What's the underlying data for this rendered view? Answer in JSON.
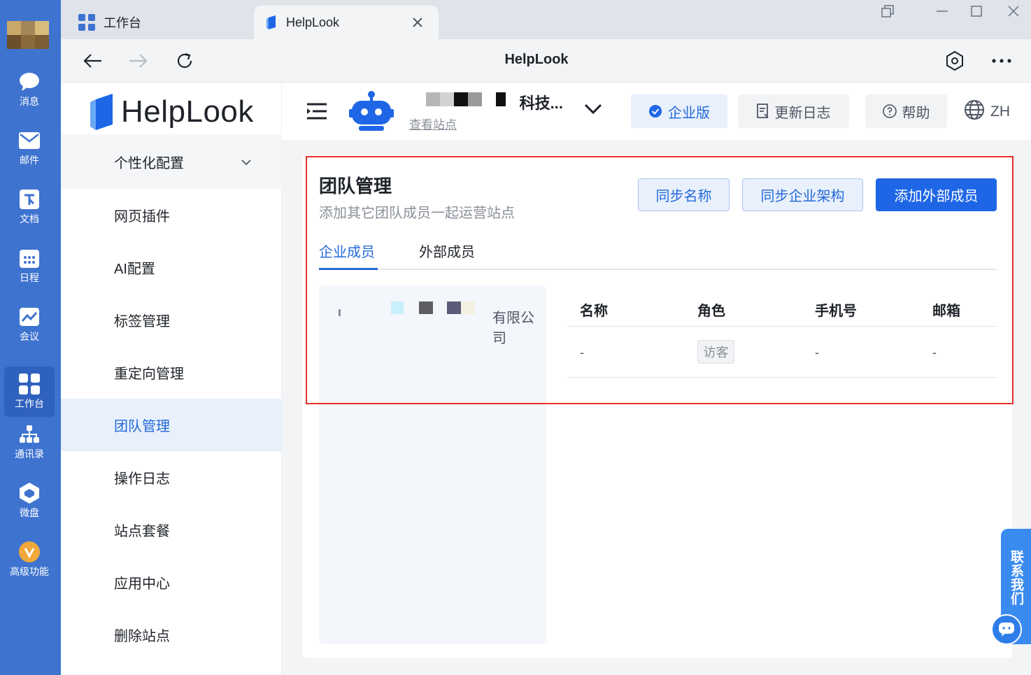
{
  "rail": {
    "items": [
      {
        "label": "消息",
        "icon": "message-icon"
      },
      {
        "label": "邮件",
        "icon": "mail-icon"
      },
      {
        "label": "文档",
        "icon": "document-icon"
      },
      {
        "label": "日程",
        "icon": "calendar-icon"
      },
      {
        "label": "会议",
        "icon": "meeting-icon"
      },
      {
        "label": "工作台",
        "icon": "workbench-icon",
        "active": true
      },
      {
        "label": "通讯录",
        "icon": "contacts-icon"
      },
      {
        "label": "微盘",
        "icon": "drive-icon"
      },
      {
        "label": "高级功能",
        "icon": "premium-icon"
      }
    ]
  },
  "tabs": [
    {
      "label": "工作台"
    },
    {
      "label": "HelpLook",
      "active": true
    }
  ],
  "navbar": {
    "title": "HelpLook"
  },
  "logo": {
    "text": "HelpLook"
  },
  "sidebar": {
    "items": [
      {
        "label": "个性化配置"
      },
      {
        "label": "网页插件"
      },
      {
        "label": "AI配置"
      },
      {
        "label": "标签管理"
      },
      {
        "label": "重定向管理"
      },
      {
        "label": "团队管理",
        "active": true
      },
      {
        "label": "操作日志"
      },
      {
        "label": "站点套餐"
      },
      {
        "label": "应用中心"
      },
      {
        "label": "删除站点"
      }
    ]
  },
  "header": {
    "site_name": "科技...",
    "view_site": "查看站点",
    "enterprise": "企业版",
    "changelog": "更新日志",
    "help": "帮助",
    "lang": "ZH"
  },
  "team": {
    "title": "团队管理",
    "subtitle": "添加其它团队成员一起运营站点",
    "sync_name": "同步名称",
    "sync_org": "同步企业架构",
    "add_external": "添加外部成员",
    "tab_enterprise": "企业成员",
    "tab_external": "外部成员",
    "org_name": "有限公司",
    "columns": {
      "name": "名称",
      "role": "角色",
      "phone": "手机号",
      "email": "邮箱"
    },
    "row": {
      "name": "-",
      "role": "访客",
      "phone": "-",
      "email": "-"
    }
  },
  "contact": {
    "label": "联系我们"
  },
  "colors": {
    "rail": "#3e73d0",
    "primary": "#1e66e6",
    "accent_text": "#2469d8",
    "highlight_border": "#e8312a"
  }
}
